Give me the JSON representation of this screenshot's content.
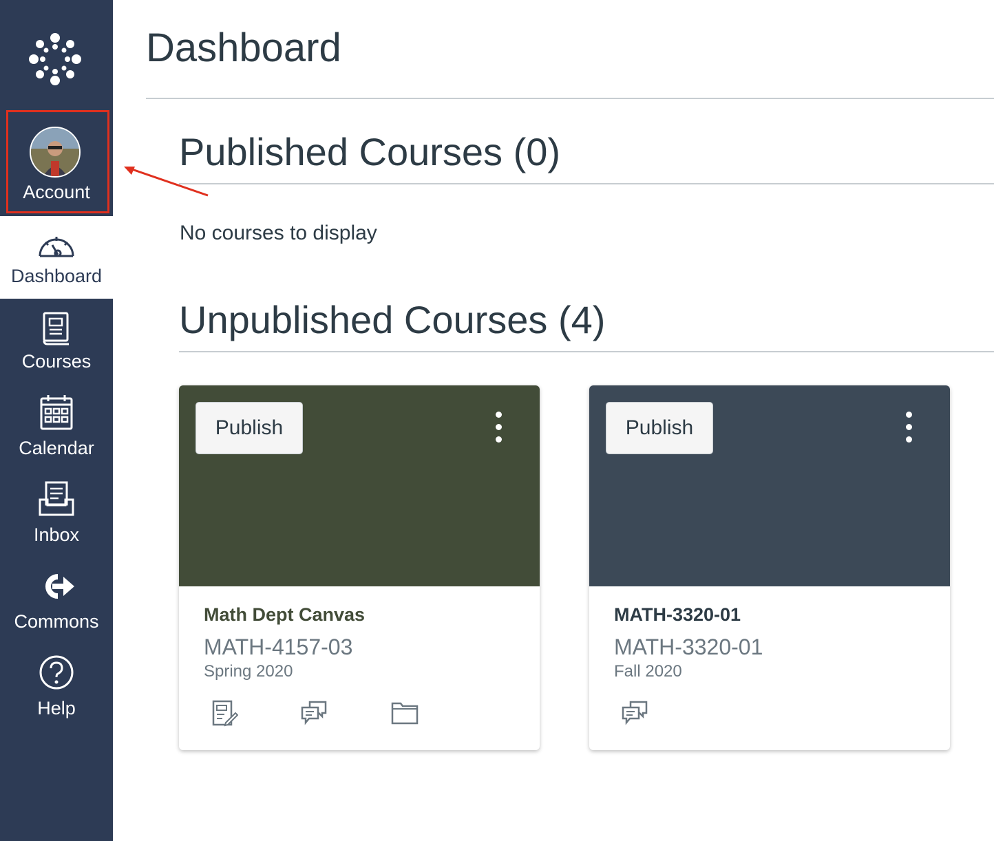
{
  "nav": {
    "account_label": "Account",
    "items": [
      {
        "label": "Dashboard",
        "icon": "dashboard-icon",
        "active": true
      },
      {
        "label": "Courses",
        "icon": "courses-icon"
      },
      {
        "label": "Calendar",
        "icon": "calendar-icon"
      },
      {
        "label": "Inbox",
        "icon": "inbox-icon"
      },
      {
        "label": "Commons",
        "icon": "commons-icon"
      },
      {
        "label": "Help",
        "icon": "help-icon"
      }
    ],
    "colors": {
      "background": "#2d3b55",
      "highlight": "#e0301e"
    }
  },
  "page": {
    "title": "Dashboard"
  },
  "published": {
    "title": "Published Courses (0)",
    "empty_text": "No courses to display"
  },
  "unpublished": {
    "title": "Unpublished Courses (4)",
    "cards": [
      {
        "publish_label": "Publish",
        "name": "Math Dept Canvas",
        "code": "MATH-4157-03",
        "term": "Spring 2020",
        "color": "#424c38",
        "name_color": "#424c38",
        "icons": [
          "assignments-icon",
          "discussions-icon",
          "files-icon"
        ]
      },
      {
        "publish_label": "Publish",
        "name": "MATH-3320-01",
        "code": "MATH-3320-01",
        "term": "Fall 2020",
        "color": "#3c4957",
        "name_color": "#2d3b45",
        "icons": [
          "discussions-icon"
        ]
      }
    ]
  }
}
